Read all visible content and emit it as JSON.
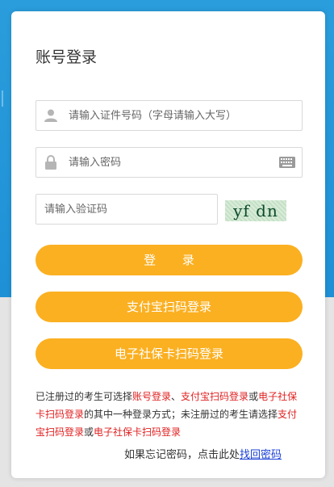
{
  "login": {
    "title": "账号登录",
    "id_placeholder": "请输入证件号码（字母请输入大写）",
    "password_placeholder": "请输入密码",
    "captcha_placeholder": "请输入验证码",
    "captcha_text": "yf dn",
    "login_button": "登 录",
    "alipay_button": "支付宝扫码登录",
    "social_card_button": "电子社保卡扫码登录"
  },
  "notice": {
    "t1": "已注册过的考生可选择",
    "r1": "账号登录",
    "t2": "、",
    "r2": "支付宝扫码登录",
    "t3": "或",
    "r3": "电子社保卡扫码登录",
    "t4": "的其中一种登录方式；未注册过的考生请选择",
    "r4": "支付宝扫码登录",
    "t5": "或",
    "r5": "电子社保卡扫码登录"
  },
  "forgot": {
    "prefix": "如果忘记密码，点击此处",
    "link": "找回密码"
  },
  "icons": {
    "user": "user-icon",
    "lock": "lock-icon",
    "keyboard": "keyboard-icon"
  },
  "colors": {
    "primary_blue": "#1e90d6",
    "button_orange": "#fbb021",
    "highlight_red": "#e02020",
    "link_blue": "#1a3fd6"
  }
}
